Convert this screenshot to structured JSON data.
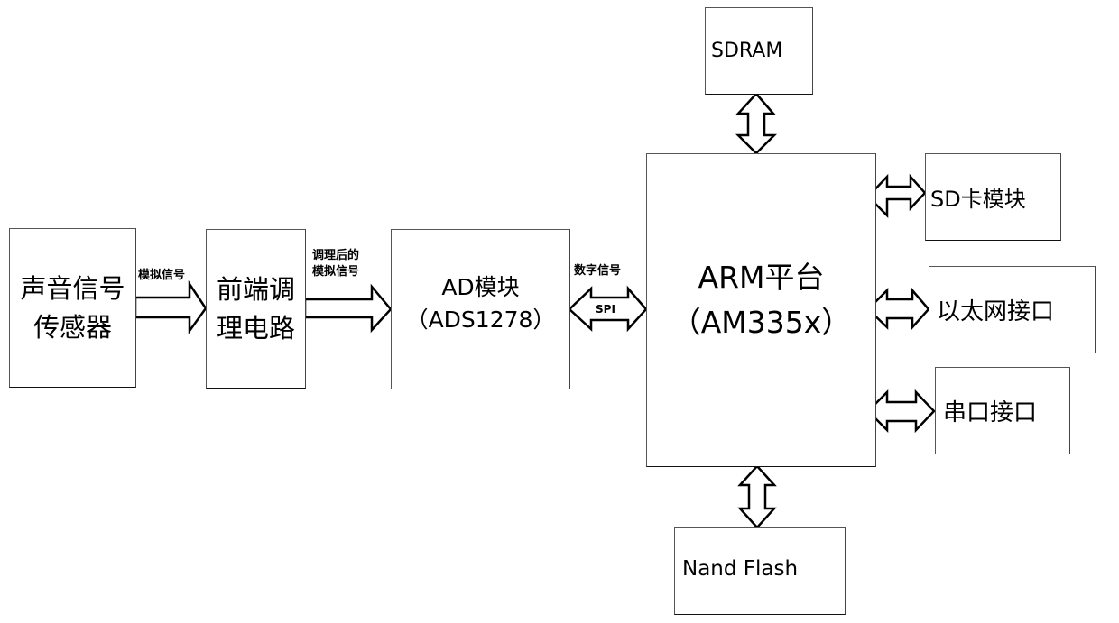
{
  "blocks": {
    "sensor": {
      "lines": [
        "声音信号",
        "传感器"
      ]
    },
    "frontend": {
      "lines": [
        "前端调",
        "理电路"
      ]
    },
    "ad": {
      "lines": [
        "AD模块",
        "（ADS1278）"
      ]
    },
    "arm": {
      "lines": [
        "ARM平台",
        "（AM335x）"
      ]
    },
    "sdram": {
      "label": "SDRAM"
    },
    "sdcard": {
      "label": "SD卡模块"
    },
    "ethernet": {
      "label": "以太网接口"
    },
    "serial": {
      "label": "串口接口"
    },
    "nand": {
      "label": "Nand Flash"
    }
  },
  "connections": {
    "sensor_to_frontend": {
      "label": "模拟信号",
      "type": "unidirectional"
    },
    "frontend_to_ad": {
      "label_lines": [
        "调理后的",
        "模拟信号"
      ],
      "type": "unidirectional"
    },
    "ad_to_arm": {
      "label": "数字信号",
      "inner_label": "SPI",
      "type": "bidirectional"
    },
    "arm_sdram": {
      "type": "bidirectional"
    },
    "arm_sdcard": {
      "type": "bidirectional"
    },
    "arm_ethernet": {
      "type": "bidirectional"
    },
    "arm_serial": {
      "type": "bidirectional"
    },
    "arm_nand": {
      "type": "bidirectional"
    }
  }
}
